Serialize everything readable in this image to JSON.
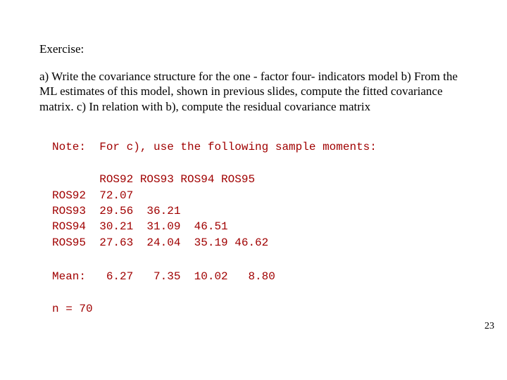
{
  "heading": "Exercise:",
  "body": "a)            Write the covariance structure for the  one - factor four- indicators model\nb)            From the ML estimates of this model, shown in previous slides, compute the fitted covariance matrix.\nc)           In relation with b), compute the residual covariance matrix",
  "note_line": "Note:  For c), use the following sample moments:",
  "table_block": "       ROS92 ROS93 ROS94 ROS95\nROS92  72.07\nROS93  29.56  36.21\nROS94  30.21  31.09  46.51\nROS95  27.63  24.04  35.19 46.62",
  "mean_line": "Mean:   6.27   7.35  10.02   8.80",
  "n_line": "n = 70",
  "page_number": "23"
}
